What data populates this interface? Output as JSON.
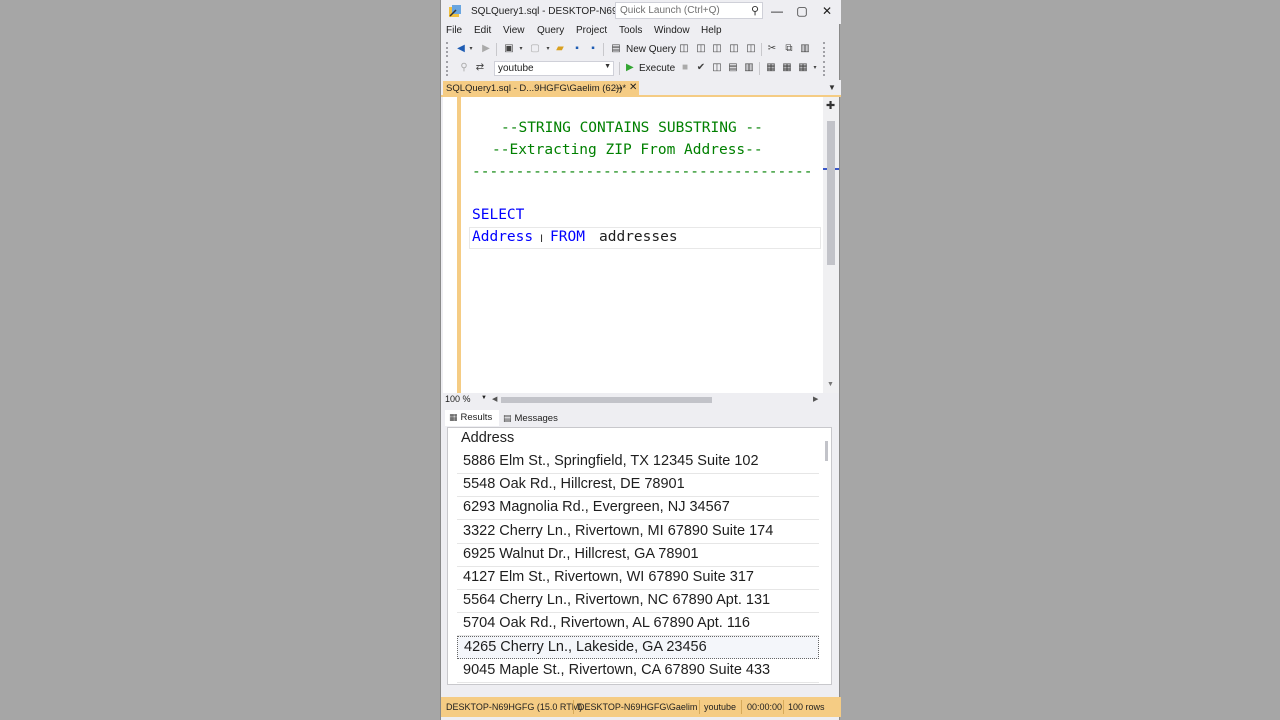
{
  "window": {
    "title": "SQLQuery1.sql - DESKTOP-N69HG...",
    "quick_launch_placeholder": "Quick Launch (Ctrl+Q)"
  },
  "menu": [
    "File",
    "Edit",
    "View",
    "Query",
    "Project",
    "Tools",
    "Window",
    "Help"
  ],
  "toolbar": {
    "new_query_label": "New Query",
    "database": "youtube",
    "execute_label": "Execute"
  },
  "document_tab": {
    "label": "SQLQuery1.sql - D...9HGFG\\Gaelim (62))*"
  },
  "editor": {
    "lines": [
      "--STRING CONTAINS SUBSTRING --",
      "--Extracting ZIP From Address--",
      "---------------------------------------",
      "SELECT",
      "Address",
      "FROM",
      "addresses"
    ],
    "zoom": "100 %"
  },
  "results": {
    "results_tab": "Results",
    "messages_tab": "Messages",
    "column": "Address",
    "rows": [
      "5886 Elm St., Springfield, TX 12345 Suite 102",
      "5548 Oak Rd., Hillcrest, DE 78901",
      "6293 Magnolia Rd., Evergreen, NJ 34567",
      "3322 Cherry Ln., Rivertown, MI 67890 Suite 174",
      "6925 Walnut Dr., Hillcrest, GA 78901",
      "4127 Elm St., Rivertown, WI 67890 Suite 317",
      "5564 Cherry Ln., Rivertown, NC 67890 Apt. 131",
      "5704 Oak Rd., Rivertown, AL 67890 Apt. 116",
      "4265 Cherry Ln., Lakeside, GA 23456",
      "9045 Maple St., Rivertown, CA 67890 Suite 433"
    ]
  },
  "status": {
    "server": "DESKTOP-N69HGFG (15.0 RTM)",
    "user": "DESKTOP-N69HGFG\\Gaelim...",
    "database": "youtube",
    "elapsed": "00:00:00",
    "rows": "100 rows"
  }
}
